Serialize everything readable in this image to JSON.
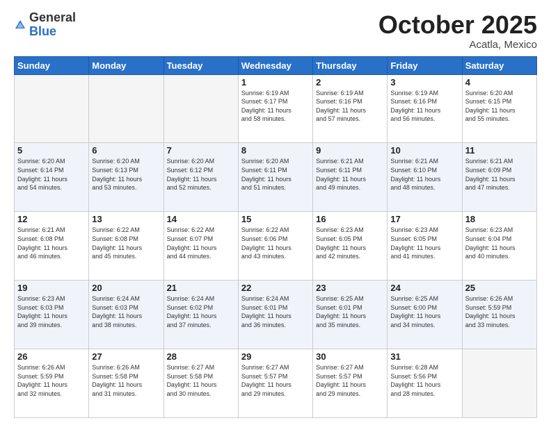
{
  "logo": {
    "general": "General",
    "blue": "Blue"
  },
  "header": {
    "month": "October 2025",
    "location": "Acatla, Mexico"
  },
  "weekdays": [
    "Sunday",
    "Monday",
    "Tuesday",
    "Wednesday",
    "Thursday",
    "Friday",
    "Saturday"
  ],
  "weeks": [
    [
      {
        "day": "",
        "info": ""
      },
      {
        "day": "",
        "info": ""
      },
      {
        "day": "",
        "info": ""
      },
      {
        "day": "1",
        "info": "Sunrise: 6:19 AM\nSunset: 6:17 PM\nDaylight: 11 hours\nand 58 minutes."
      },
      {
        "day": "2",
        "info": "Sunrise: 6:19 AM\nSunset: 6:16 PM\nDaylight: 11 hours\nand 57 minutes."
      },
      {
        "day": "3",
        "info": "Sunrise: 6:19 AM\nSunset: 6:16 PM\nDaylight: 11 hours\nand 56 minutes."
      },
      {
        "day": "4",
        "info": "Sunrise: 6:20 AM\nSunset: 6:15 PM\nDaylight: 11 hours\nand 55 minutes."
      }
    ],
    [
      {
        "day": "5",
        "info": "Sunrise: 6:20 AM\nSunset: 6:14 PM\nDaylight: 11 hours\nand 54 minutes."
      },
      {
        "day": "6",
        "info": "Sunrise: 6:20 AM\nSunset: 6:13 PM\nDaylight: 11 hours\nand 53 minutes."
      },
      {
        "day": "7",
        "info": "Sunrise: 6:20 AM\nSunset: 6:12 PM\nDaylight: 11 hours\nand 52 minutes."
      },
      {
        "day": "8",
        "info": "Sunrise: 6:20 AM\nSunset: 6:11 PM\nDaylight: 11 hours\nand 51 minutes."
      },
      {
        "day": "9",
        "info": "Sunrise: 6:21 AM\nSunset: 6:11 PM\nDaylight: 11 hours\nand 49 minutes."
      },
      {
        "day": "10",
        "info": "Sunrise: 6:21 AM\nSunset: 6:10 PM\nDaylight: 11 hours\nand 48 minutes."
      },
      {
        "day": "11",
        "info": "Sunrise: 6:21 AM\nSunset: 6:09 PM\nDaylight: 11 hours\nand 47 minutes."
      }
    ],
    [
      {
        "day": "12",
        "info": "Sunrise: 6:21 AM\nSunset: 6:08 PM\nDaylight: 11 hours\nand 46 minutes."
      },
      {
        "day": "13",
        "info": "Sunrise: 6:22 AM\nSunset: 6:08 PM\nDaylight: 11 hours\nand 45 minutes."
      },
      {
        "day": "14",
        "info": "Sunrise: 6:22 AM\nSunset: 6:07 PM\nDaylight: 11 hours\nand 44 minutes."
      },
      {
        "day": "15",
        "info": "Sunrise: 6:22 AM\nSunset: 6:06 PM\nDaylight: 11 hours\nand 43 minutes."
      },
      {
        "day": "16",
        "info": "Sunrise: 6:23 AM\nSunset: 6:05 PM\nDaylight: 11 hours\nand 42 minutes."
      },
      {
        "day": "17",
        "info": "Sunrise: 6:23 AM\nSunset: 6:05 PM\nDaylight: 11 hours\nand 41 minutes."
      },
      {
        "day": "18",
        "info": "Sunrise: 6:23 AM\nSunset: 6:04 PM\nDaylight: 11 hours\nand 40 minutes."
      }
    ],
    [
      {
        "day": "19",
        "info": "Sunrise: 6:23 AM\nSunset: 6:03 PM\nDaylight: 11 hours\nand 39 minutes."
      },
      {
        "day": "20",
        "info": "Sunrise: 6:24 AM\nSunset: 6:03 PM\nDaylight: 11 hours\nand 38 minutes."
      },
      {
        "day": "21",
        "info": "Sunrise: 6:24 AM\nSunset: 6:02 PM\nDaylight: 11 hours\nand 37 minutes."
      },
      {
        "day": "22",
        "info": "Sunrise: 6:24 AM\nSunset: 6:01 PM\nDaylight: 11 hours\nand 36 minutes."
      },
      {
        "day": "23",
        "info": "Sunrise: 6:25 AM\nSunset: 6:01 PM\nDaylight: 11 hours\nand 35 minutes."
      },
      {
        "day": "24",
        "info": "Sunrise: 6:25 AM\nSunset: 6:00 PM\nDaylight: 11 hours\nand 34 minutes."
      },
      {
        "day": "25",
        "info": "Sunrise: 6:26 AM\nSunset: 5:59 PM\nDaylight: 11 hours\nand 33 minutes."
      }
    ],
    [
      {
        "day": "26",
        "info": "Sunrise: 6:26 AM\nSunset: 5:59 PM\nDaylight: 11 hours\nand 32 minutes."
      },
      {
        "day": "27",
        "info": "Sunrise: 6:26 AM\nSunset: 5:58 PM\nDaylight: 11 hours\nand 31 minutes."
      },
      {
        "day": "28",
        "info": "Sunrise: 6:27 AM\nSunset: 5:58 PM\nDaylight: 11 hours\nand 30 minutes."
      },
      {
        "day": "29",
        "info": "Sunrise: 6:27 AM\nSunset: 5:57 PM\nDaylight: 11 hours\nand 29 minutes."
      },
      {
        "day": "30",
        "info": "Sunrise: 6:27 AM\nSunset: 5:57 PM\nDaylight: 11 hours\nand 29 minutes."
      },
      {
        "day": "31",
        "info": "Sunrise: 6:28 AM\nSunset: 5:56 PM\nDaylight: 11 hours\nand 28 minutes."
      },
      {
        "day": "",
        "info": ""
      }
    ]
  ]
}
